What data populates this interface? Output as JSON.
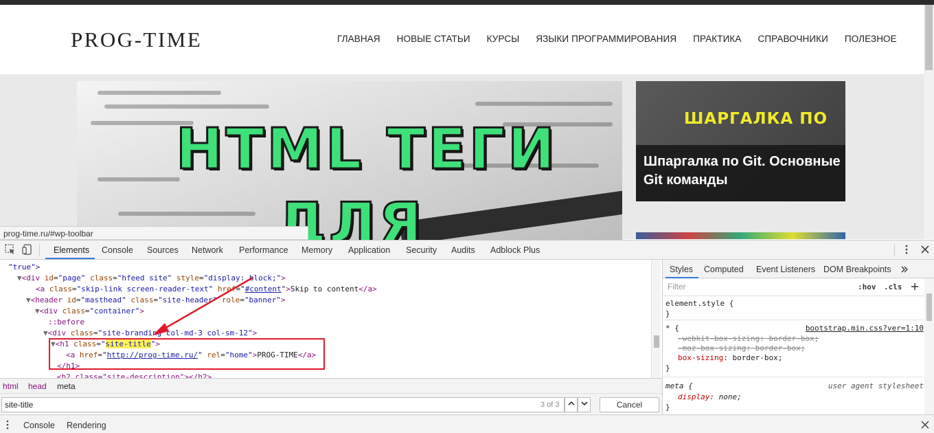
{
  "site": {
    "logo": "PROG-TIME",
    "nav": [
      "ГЛАВНАЯ",
      "НОВЫЕ СТАТЬИ",
      "КУРСЫ",
      "ЯЗЫКИ ПРОГРАММИРОВАНИЯ",
      "ПРАКТИКА",
      "СПРАВОЧНИКИ",
      "ПОЛЕЗНОЕ"
    ],
    "hero_line1": "HTML ТЕГИ",
    "hero_line2": "ДЛЯ",
    "card_badge": "ШАРГАЛКА ПО",
    "card_title": "Шпаргалка по Git. Основные Git команды",
    "status_url": "prog-time.ru/#wp-toolbar"
  },
  "devtools": {
    "tabs": [
      "Elements",
      "Console",
      "Sources",
      "Network",
      "Performance",
      "Memory",
      "Application",
      "Security",
      "Audits",
      "Adblock Plus"
    ],
    "active_tab": "Elements",
    "code": {
      "true_attr": "\"true\">",
      "div_page": {
        "tag": "div",
        "id_attr": "id",
        "id_val": "\"page\"",
        "class_attr": "class",
        "class_val": "\"hfeed site\"",
        "style_attr": "style",
        "style_val": "\"display: block;\""
      },
      "skip_link": {
        "href_val": "#content",
        "class_val": "\"skip-link screen-reader-text\"",
        "text": "Skip to content"
      },
      "header": {
        "id_val": "\"masthead\"",
        "class_val": "\"site-header\"",
        "role_val": "\"banner\""
      },
      "container_class": "\"container\"",
      "before": "::before",
      "branding_class": "\"site-branding col-md-3 col-sm-12\"",
      "h1_class": "site-title",
      "a_href": "http://prog-time.ru/",
      "a_rel": "\"home\"",
      "a_text": "PROG-TIME",
      "h2_partial": "<h2 class=\"site-description\"></h2>"
    },
    "breadcrumbs": [
      "html",
      "head",
      "meta"
    ],
    "search": {
      "value": "site-title",
      "count": "3 of 3",
      "cancel": "Cancel"
    },
    "drawer": [
      "Console",
      "Rendering"
    ],
    "styles": {
      "tabs": [
        "Styles",
        "Computed",
        "Event Listeners",
        "DOM Breakpoints"
      ],
      "filter_placeholder": "Filter",
      "hov": ":hov",
      "cls": ".cls",
      "element_style": "element.style {",
      "close_brace": "}",
      "star_rule": "* {",
      "star_source": "bootstrap.min.css?ver=1:10",
      "webkit_prop": "-webkit-box-sizing: border-box;",
      "moz_prop": "-moz-box-sizing: border-box;",
      "box_prop": "box-sizing",
      "box_val": "border-box;",
      "meta_rule": "meta {",
      "ua_label": "user agent stylesheet",
      "display_prop": "display",
      "display_val": "none;"
    }
  }
}
